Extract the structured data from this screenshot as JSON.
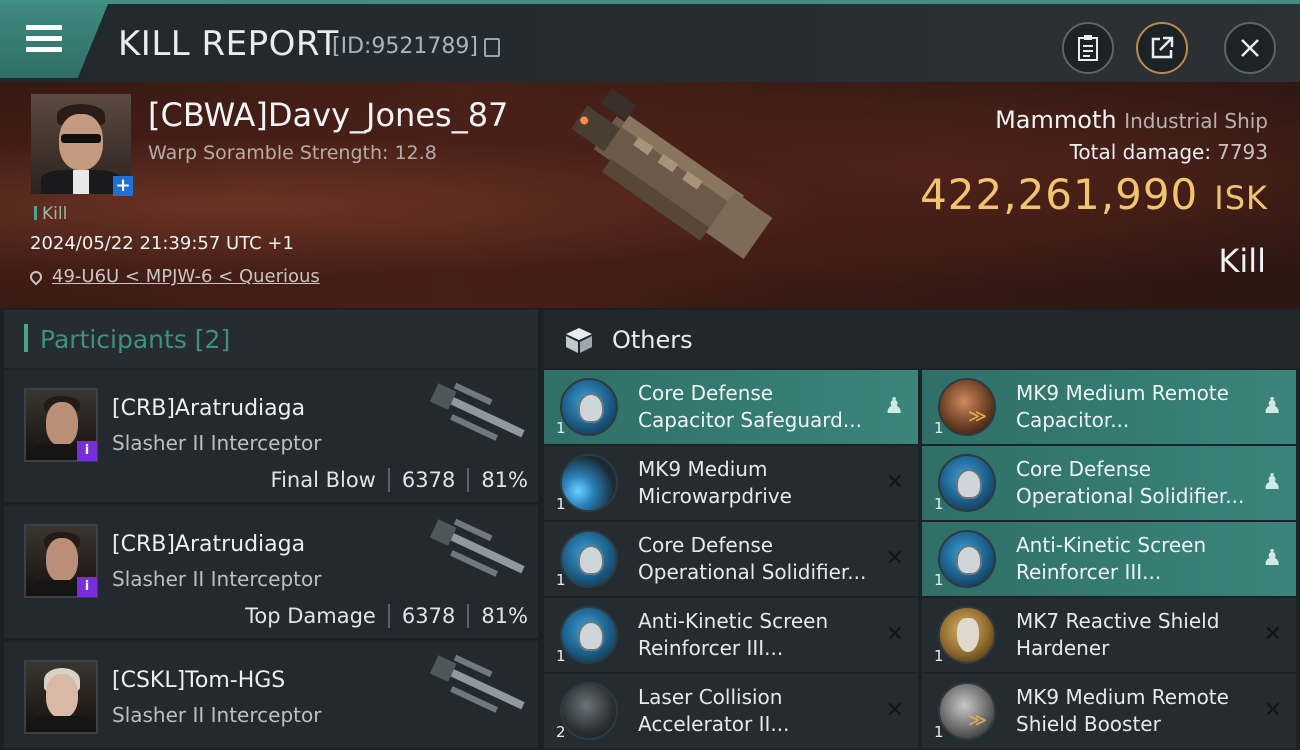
{
  "header": {
    "title": "KILL REPORT",
    "report_id": "[ID:9521789]",
    "icons": [
      "menu-icon",
      "copy-icon",
      "clipboard-icon",
      "share-icon",
      "close-icon"
    ]
  },
  "victim": {
    "name": "[CBWA]Davy_Jones_87",
    "scramble": "Warp Soramble Strength: 12.8",
    "tag": "Kill",
    "timestamp": "2024/05/22 21:39:57 UTC +1",
    "location": "49-U6U < MPJW-6 < Querious",
    "ship_name": "Mammoth",
    "ship_class": "Industrial Ship",
    "total_damage_label": "Total damage:",
    "total_damage": "7793",
    "isk_value": "422,261,990",
    "isk_unit": "ISK",
    "result": "Kill"
  },
  "participants": {
    "label": "Participants [2]",
    "rows": [
      {
        "name": "[CRB]Aratrudiaga",
        "ship": "Slasher II Interceptor",
        "role": "Final Blow",
        "damage": "6378",
        "percent": "81%"
      },
      {
        "name": "[CRB]Aratrudiaga",
        "ship": "Slasher II Interceptor",
        "role": "Top Damage",
        "damage": "6378",
        "percent": "81%"
      },
      {
        "name": "[CSKL]Tom-HGS",
        "ship": "Slasher II Interceptor",
        "role": "",
        "damage": "",
        "percent": ""
      }
    ]
  },
  "others": {
    "label": "Others",
    "items": [
      {
        "name": "Core Defense Capacitor Safeguard...",
        "qty": "1",
        "status": "dropped",
        "icon": "blue"
      },
      {
        "name": "MK9 Medium Remote Capacitor...",
        "qty": "1",
        "status": "dropped",
        "icon": "copper"
      },
      {
        "name": "MK9 Medium Microwarpdrive",
        "qty": "1",
        "status": "destroyed",
        "icon": "mwd"
      },
      {
        "name": "Core Defense Operational Solidifier...",
        "qty": "1",
        "status": "dropped",
        "icon": "blue"
      },
      {
        "name": "Core Defense Operational Solidifier...",
        "qty": "1",
        "status": "destroyed",
        "icon": "blue"
      },
      {
        "name": "Anti-Kinetic Screen Reinforcer III...",
        "qty": "1",
        "status": "dropped",
        "icon": "blue"
      },
      {
        "name": "Anti-Kinetic Screen Reinforcer III...",
        "qty": "1",
        "status": "destroyed",
        "icon": "blue"
      },
      {
        "name": "MK7 Reactive Shield Hardener",
        "qty": "1",
        "status": "destroyed",
        "icon": "gold"
      },
      {
        "name": "Laser Collision Accelerator II...",
        "qty": "2",
        "status": "destroyed",
        "icon": "dark"
      },
      {
        "name": "MK9 Medium Remote Shield Booster",
        "qty": "1",
        "status": "destroyed",
        "icon": "silver"
      }
    ]
  }
}
